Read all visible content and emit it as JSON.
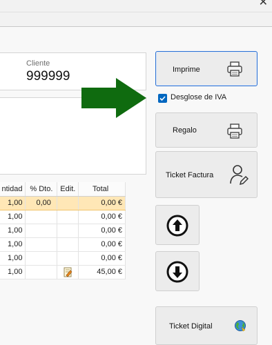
{
  "window": {
    "close_glyph": "✕"
  },
  "cliente": {
    "label": "Cliente",
    "value": "999999"
  },
  "grid": {
    "columns": [
      "ntidad",
      "% Dto.",
      "Edit.",
      "Total"
    ],
    "rows": [
      {
        "cantidad": "1,00",
        "dto": "0,00",
        "edit_icon": "",
        "total": "0,00 €",
        "selected": true
      },
      {
        "cantidad": "1,00",
        "dto": "",
        "edit_icon": "",
        "total": "0,00 €",
        "selected": false
      },
      {
        "cantidad": "1,00",
        "dto": "",
        "edit_icon": "",
        "total": "0,00 €",
        "selected": false
      },
      {
        "cantidad": "1,00",
        "dto": "",
        "edit_icon": "",
        "total": "0,00 €",
        "selected": false
      },
      {
        "cantidad": "1,00",
        "dto": "",
        "edit_icon": "",
        "total": "0,00 €",
        "selected": false
      },
      {
        "cantidad": "1,00",
        "dto": "",
        "edit_icon": "edit-note-icon",
        "total": "45,00 €",
        "selected": false
      }
    ]
  },
  "buttons": {
    "imprime": {
      "label": "Imprime",
      "icon": "printer-icon"
    },
    "regalo": {
      "label": "Regalo",
      "icon": "printer-icon"
    },
    "ticket_factura": {
      "label": "Ticket Factura",
      "icon": "user-edit-icon"
    },
    "up": {
      "icon": "arrow-up-circle-icon"
    },
    "down": {
      "icon": "arrow-down-circle-icon"
    },
    "ticket_digital": {
      "label": "Ticket Digital",
      "icon": "globe-icon"
    }
  },
  "desglose_iva": {
    "label": "Desglose de IVA",
    "checked": true
  },
  "annotation": {
    "icon": "green-arrow-icon",
    "color": "#0f6b0f"
  },
  "colors": {
    "accent": "#0067c0",
    "selected_row": "#ffe7b6",
    "primary_border": "#2a6fd1"
  }
}
